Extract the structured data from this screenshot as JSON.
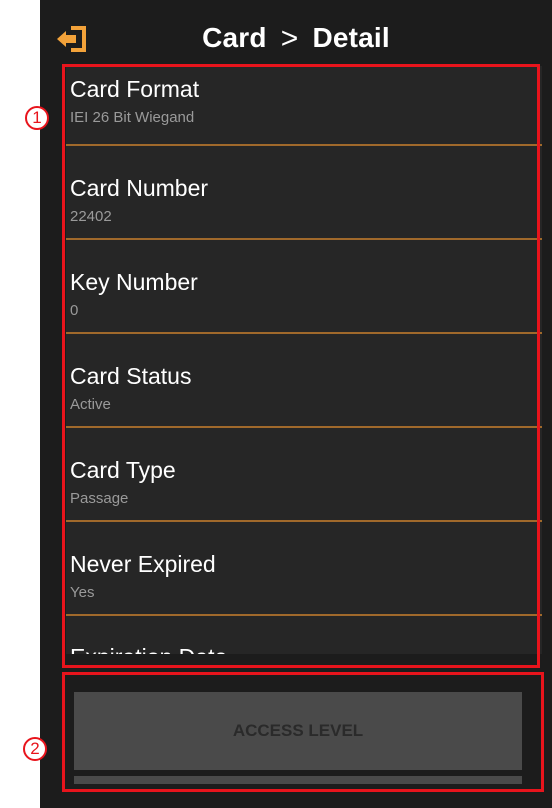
{
  "header": {
    "title_part1": "Card",
    "separator": ">",
    "title_part2": "Detail"
  },
  "details": [
    {
      "label": "Card Format",
      "value": "IEI 26 Bit Wiegand"
    },
    {
      "label": "Card Number",
      "value": "22402"
    },
    {
      "label": "Key Number",
      "value": "0"
    },
    {
      "label": "Card Status",
      "value": "Active"
    },
    {
      "label": "Card Type",
      "value": "Passage"
    },
    {
      "label": "Never Expired",
      "value": "Yes"
    },
    {
      "label": "Expiration Date",
      "value": ""
    }
  ],
  "footer": {
    "access_level_label": "ACCESS LEVEL"
  },
  "annotations": [
    "1",
    "2"
  ],
  "colors": {
    "background": "#1c1c1c",
    "divider": "#a0692b",
    "accent_icon": "#f2a23a",
    "annotation": "#e8141c"
  },
  "icons": {
    "back": "back-arrow-exit-icon"
  }
}
